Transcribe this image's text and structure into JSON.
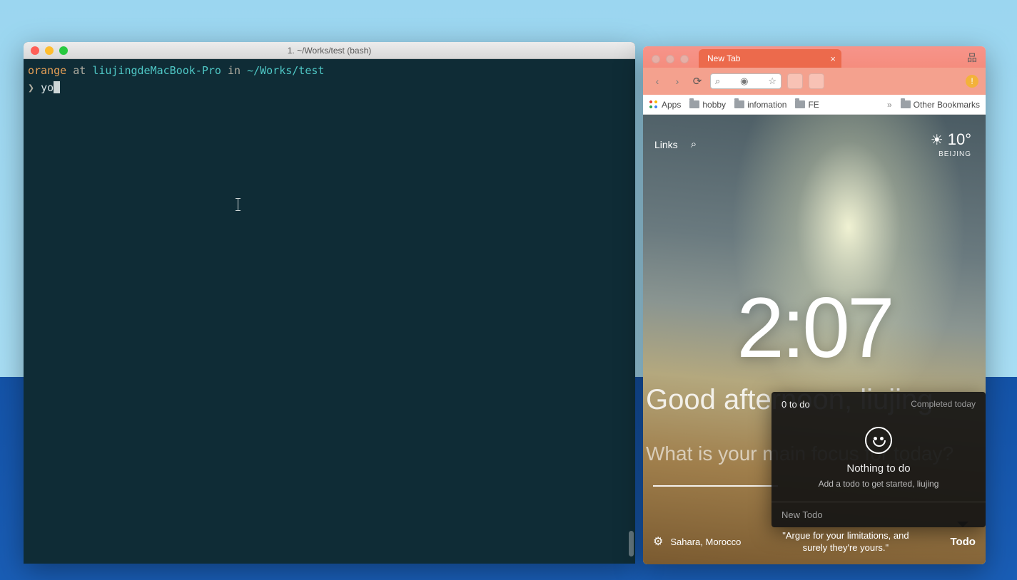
{
  "terminal": {
    "title": "1. ~/Works/test (bash)",
    "user": "orange",
    "at": " at ",
    "host": "liujingdeMacBook-Pro",
    "in": " in ",
    "cwd": "~/Works/test",
    "prompt_symbol": "❯",
    "typed": "yo"
  },
  "browser": {
    "tab": {
      "title": "New Tab"
    },
    "bookmarks": {
      "apps": "Apps",
      "items": [
        "hobby",
        "infomation",
        "FE"
      ],
      "overflow": "»",
      "other": "Other Bookmarks"
    },
    "ntp": {
      "links_label": "Links",
      "weather": {
        "temp": "10°",
        "location": "BEIJING"
      },
      "time": "2:07",
      "greeting": "Good afternoon, liujing",
      "focus_question": "What is your main focus for today?",
      "photo_credit": "Sahara, Morocco",
      "quote_line1": "\"Argue for your limitations, and",
      "quote_line2": "surely they're yours.\"",
      "todo_label": "Todo"
    },
    "todo_popover": {
      "count_label": "0 to do",
      "completed_label": "Completed today",
      "empty_title": "Nothing to do",
      "empty_sub": "Add a todo to get started, liujing",
      "new_placeholder": "New Todo"
    }
  }
}
